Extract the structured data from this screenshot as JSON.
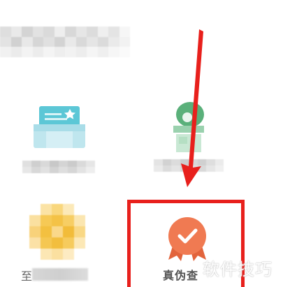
{
  "menu": {
    "items": [
      {
        "label": "真伪查",
        "icon": "verify-badge-icon",
        "highlighted": true
      },
      {
        "label": "zhi",
        "icon": "yellow-app-icon",
        "highlighted": false
      }
    ]
  },
  "watermark": {
    "text": "软件技巧"
  },
  "colors": {
    "highlight_red": "#e8201c",
    "verify_orange": "#f07a52",
    "ticket_teal": "#5cc7d6",
    "green": "#5ab07a",
    "yellow": "#f6c955"
  }
}
